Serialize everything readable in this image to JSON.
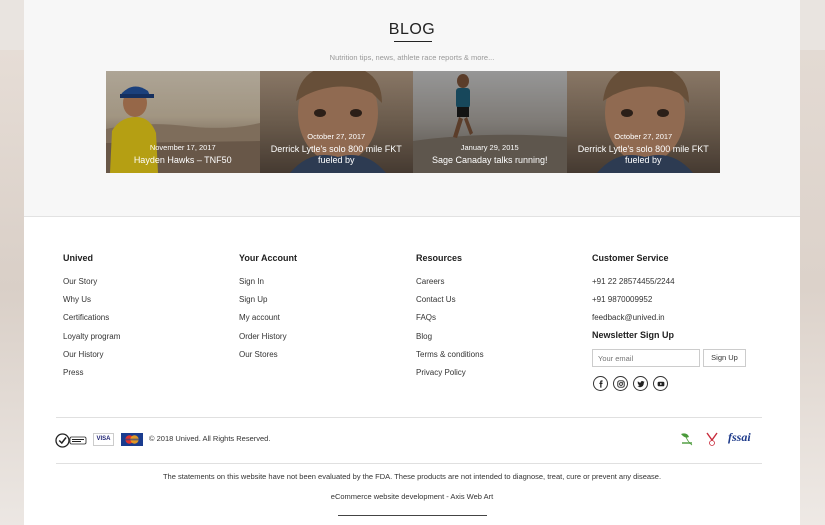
{
  "blog": {
    "title": "BLOG",
    "subtitle": "Nutrition tips, news, athlete race reports & more...",
    "posts": [
      {
        "date": "November 17, 2017",
        "title": "Hayden Hawks – TNF50"
      },
      {
        "date": "October 27, 2017",
        "title": "Derrick Lytle's solo 800 mile FKT fueled by"
      },
      {
        "date": "January 29, 2015",
        "title": "Sage Canaday talks running!"
      },
      {
        "date": "October 27, 2017",
        "title": "Derrick Lytle's solo 800 mile FKT fueled by"
      }
    ]
  },
  "footer": {
    "unived": {
      "heading": "Unived",
      "links": [
        "Our Story",
        "Why Us",
        "Certifications",
        "Loyalty program",
        "Our History",
        "Press"
      ]
    },
    "account": {
      "heading": "Your Account",
      "links": [
        "Sign In",
        "Sign Up",
        "My account",
        "Order History",
        "Our Stores"
      ]
    },
    "resources": {
      "heading": "Resources",
      "links": [
        "Careers",
        "Contact Us",
        "FAQs",
        "Blog",
        "Terms & conditions",
        "Privacy Policy"
      ]
    },
    "service": {
      "heading": "Customer Service",
      "phone1": "+91 22 28574455/2244",
      "phone2": "+91 9870009952",
      "email": "feedback@unived.in"
    },
    "newsletter": {
      "heading": "Newsletter Sign Up",
      "placeholder": "Your email",
      "button": "Sign Up"
    },
    "social_icons": [
      "facebook-icon",
      "instagram-icon",
      "twitter-icon",
      "youtube-icon"
    ],
    "copyright": "© 2018 Unived. All Rights Reserved.",
    "payment": {
      "visa": "VISA"
    },
    "certs": {
      "fssai": "fssai"
    },
    "disclaimer": "The statements on this website have not been evaluated by the FDA. These products are not intended to diagnose, treat, cure or prevent any disease.",
    "dev_credit": "eCommerce website development - Axis Web Art"
  }
}
